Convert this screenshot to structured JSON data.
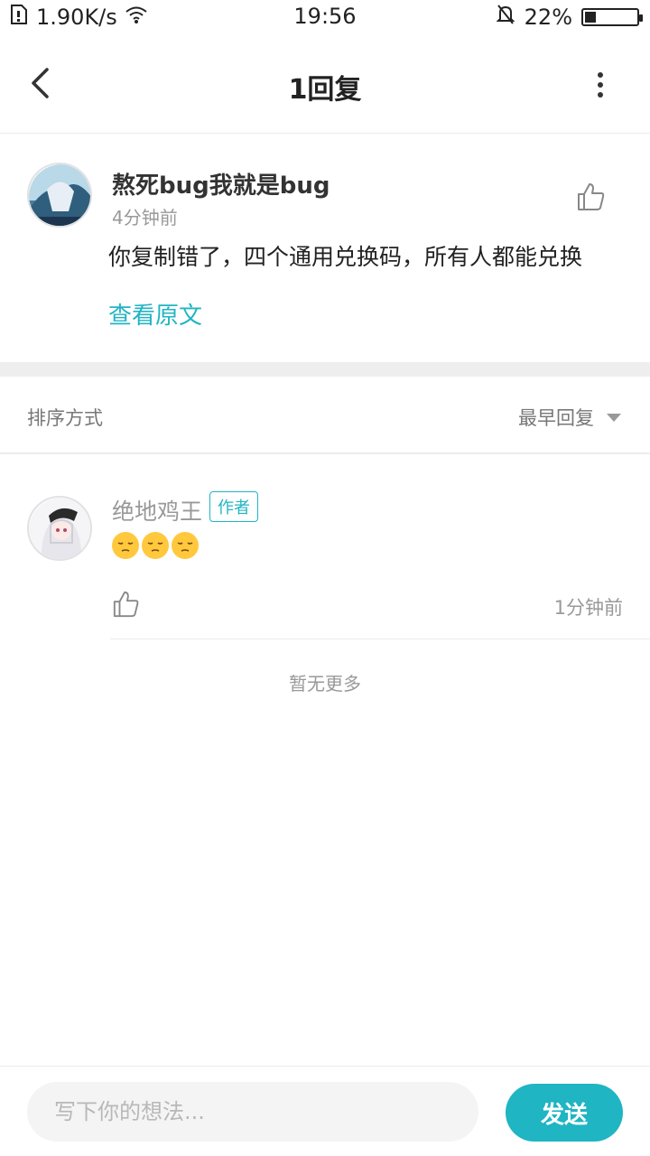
{
  "status_bar": {
    "speed": "1.90K/s",
    "time": "19:56",
    "battery": "22%",
    "battery_level": 0.22
  },
  "header": {
    "title": "1回复"
  },
  "comment": {
    "author": "熬死bug我就是bug",
    "time": "4分钟前",
    "text": "你复制错了，四个通用兑换码，所有人都能兑换",
    "view_original": "查看原文"
  },
  "sort": {
    "label": "排序方式",
    "selected": "最早回复"
  },
  "reply": {
    "author": "绝地鸡王",
    "badge": "作者",
    "emoji_count": 3,
    "time": "1分钟前"
  },
  "no_more": "暂无更多",
  "input": {
    "placeholder": "写下你的想法..."
  },
  "send_label": "发送",
  "colors": {
    "accent": "#1fb5c2",
    "divider": "#eeeeee"
  },
  "icons": [
    "sim-icon",
    "wifi-icon",
    "mute-bell-icon",
    "battery-icon",
    "back-arrow-icon",
    "more-vertical-icon",
    "thumbs-up-icon",
    "sort-triangle-icon",
    "pensive-face-emoji"
  ]
}
